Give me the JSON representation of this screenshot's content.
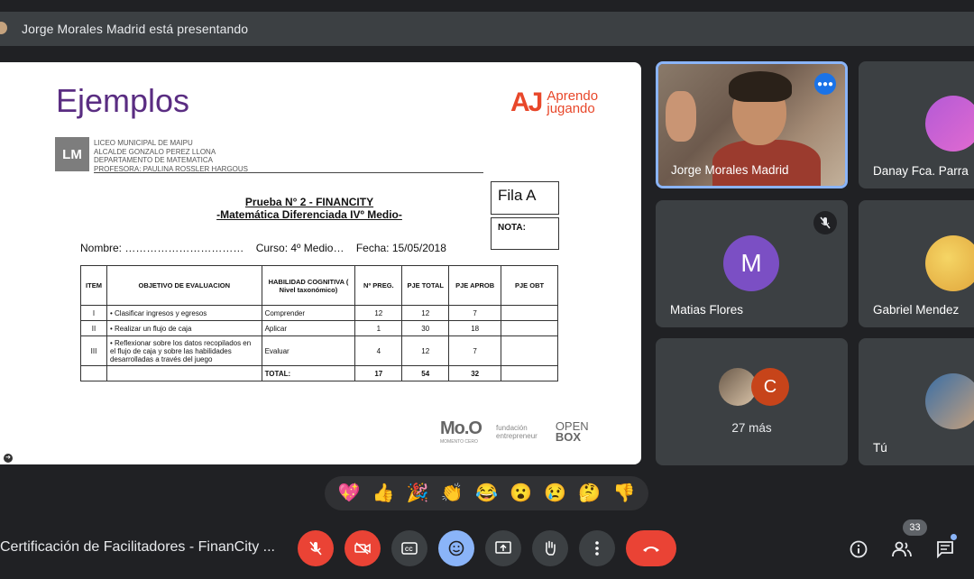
{
  "presenting": "Jorge Morales Madrid está presentando",
  "slide": {
    "title": "Ejemplos",
    "brand_aj": "AJ",
    "brand_line1": "Aprendo",
    "brand_line2": "jugando",
    "school_logo": "LM",
    "school_lines": [
      "LICEO MUNICIPAL DE MAIPU",
      "ALCALDE GONZALO PEREZ LLONA",
      "DEPARTAMENTO DE MATEMATICA",
      "PROFESORA: PAULINA ROSSLER HARGOUS"
    ],
    "fila": "Fila A",
    "nota": "NOTA:",
    "prueba_line1": "Prueba N° 2 - FINANCITY",
    "prueba_line2": "-Matemática Diferenciada IVº Medio-",
    "nombre": "Nombre: ……………………………",
    "curso": "Curso: 4º Medio…",
    "fecha": "Fecha: 15/05/2018",
    "table": {
      "headers": [
        "ITEM",
        "OBJETIVO DE EVALUACION",
        "HABILIDAD COGNITIVA ( Nivel taxonómico)",
        "Nº PREG.",
        "PJE TOTAL",
        "PJE APROB",
        "PJE OBT"
      ],
      "rows": [
        [
          "I",
          "• Clasificar ingresos y egresos",
          "Comprender",
          "12",
          "12",
          "7",
          ""
        ],
        [
          "II",
          "• Realizar un flujo de caja",
          "Aplicar",
          "1",
          "30",
          "18",
          ""
        ],
        [
          "III",
          "• Reflexionar sobre los datos recopilados en el flujo de caja y sobre las habilidades desarrolladas a través del juego",
          "Evaluar",
          "4",
          "12",
          "7",
          ""
        ]
      ],
      "total": [
        "",
        "",
        "TOTAL:",
        "17",
        "54",
        "32",
        ""
      ]
    },
    "footer_moo": "Mo.O",
    "footer_moo_sub": "MOMENTO CERO",
    "footer_fund1": "fundación",
    "footer_fund2": "entrepreneur",
    "footer_open": "OPEN",
    "footer_box": "BOX"
  },
  "participants": {
    "jorge": "Jorge Morales Madrid",
    "danay": "Danay Fca. Parra",
    "matias": "Matias Flores",
    "matias_initial": "M",
    "gabriel": "Gabriel Mendez",
    "more": "27 más",
    "more_initial": "C",
    "you": "Tú"
  },
  "reactions": [
    "💖",
    "👍",
    "🎉",
    "👏",
    "😂",
    "😮",
    "😢",
    "🤔",
    "👎"
  ],
  "meeting_name": "Certificación de Facilitadores - FinanCity ...",
  "participant_count": "33",
  "colors": {
    "matias_avatar": "#7b4fc4",
    "more_avatar": "#c7441a",
    "end_call": "#ea4335",
    "reaction_active": "#8ab4f8"
  }
}
